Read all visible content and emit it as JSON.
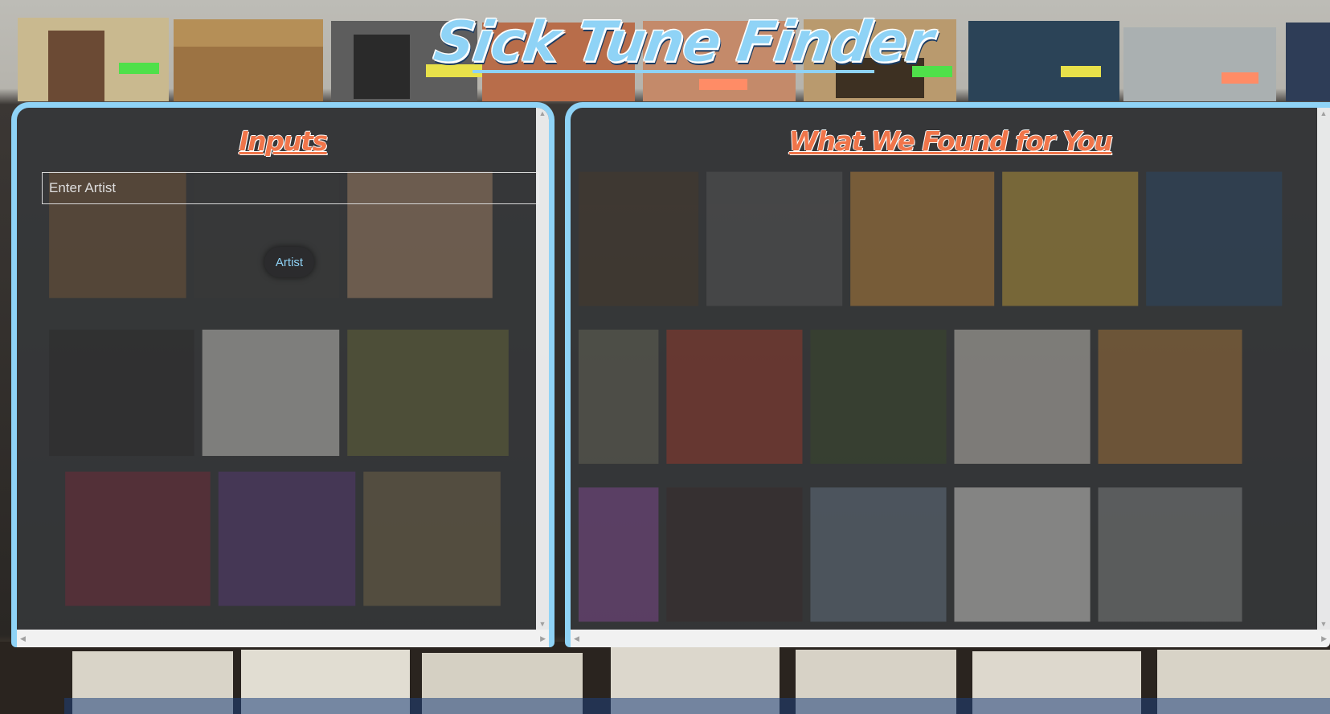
{
  "app": {
    "title": "Sick Tune Finder"
  },
  "colors": {
    "accent_blue": "#8fd3f6",
    "heading_orange": "#f0754a",
    "panel_bg": "#36383a"
  },
  "inputs_panel": {
    "heading": "Inputs",
    "artist_input": {
      "value": "",
      "placeholder": "Enter Artist"
    },
    "artist_button_label": "Artist"
  },
  "results_panel": {
    "heading": "What We Found for You"
  },
  "icons": {
    "scroll_left": "scroll-left-arrow-icon",
    "scroll_right": "scroll-right-arrow-icon",
    "scroll_up": "scroll-up-arrow-icon",
    "scroll_down": "scroll-down-arrow-icon"
  },
  "glyphs": {
    "left": "◀",
    "right": "▶",
    "up": "▲",
    "down": "▼"
  }
}
